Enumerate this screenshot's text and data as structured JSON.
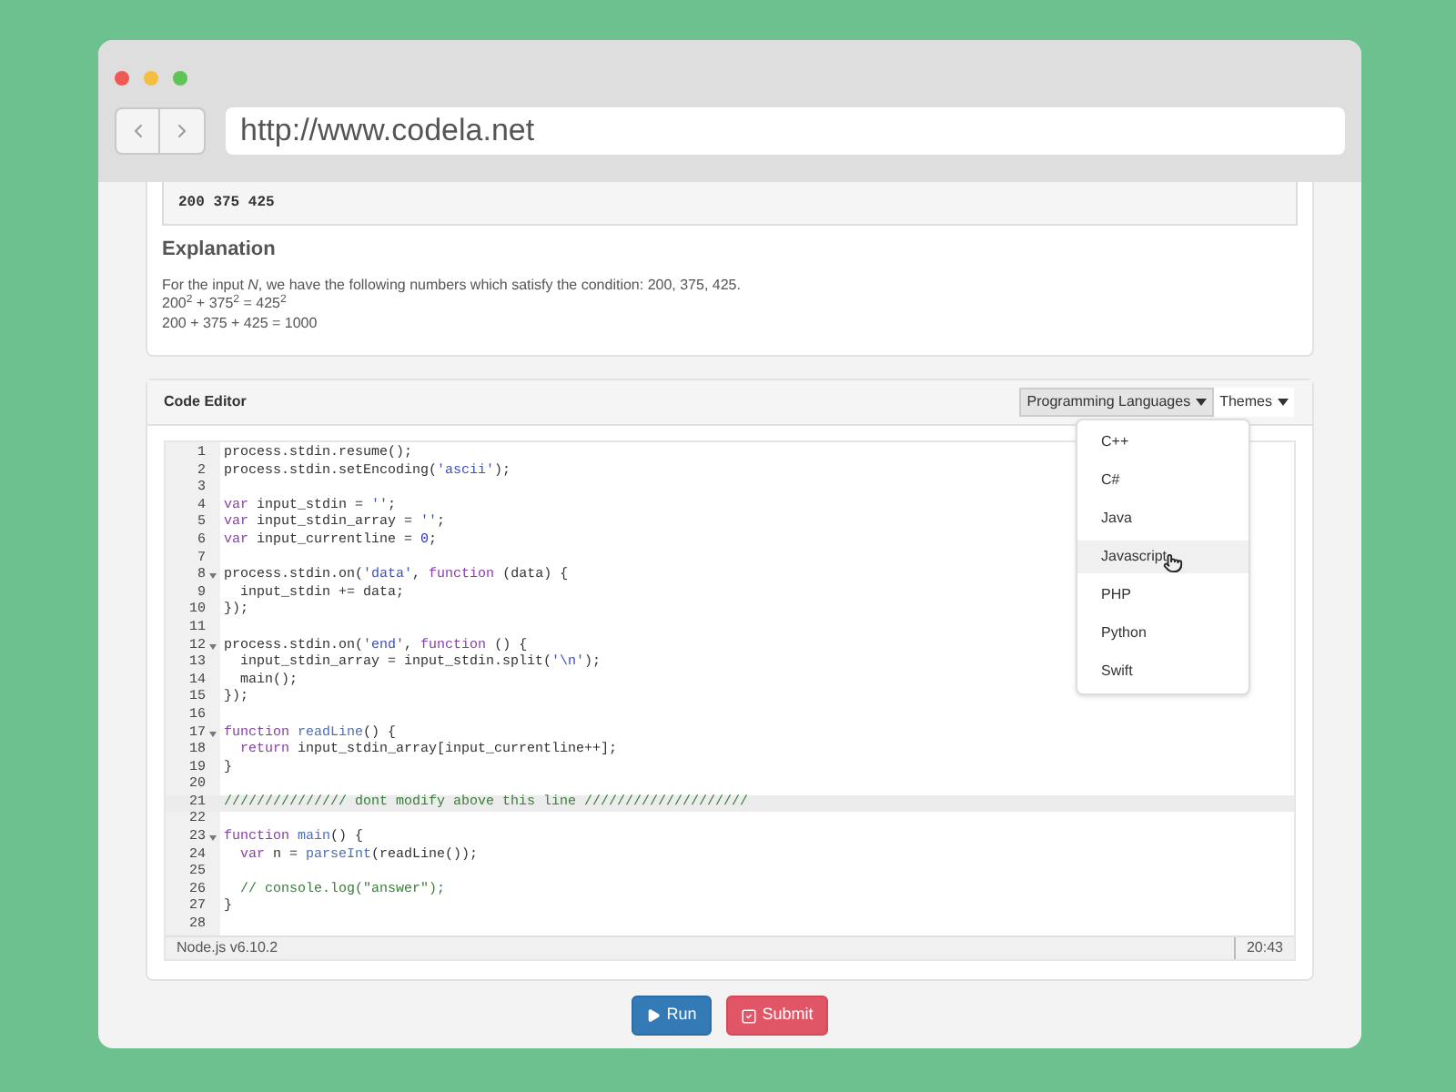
{
  "browser": {
    "url": "http://www.codela.net"
  },
  "sample_output": "200 375 425",
  "explanation": {
    "title": "Explanation",
    "lines": [
      "For the input *N*, we have the following numbers which satisfy the condition: 200, 375, 425.",
      "200$^{2}$ + 375$^{2}$ = 425$^{2}$",
      "200 + 375 + 425 = 1000"
    ]
  },
  "code_editor": {
    "title": "Code Editor",
    "toolbar": [
      {
        "label": "Programming Languages",
        "expanded": true
      },
      {
        "label": "Themes",
        "expanded": false
      }
    ],
    "language_menu": [
      {
        "label": "C++",
        "selected": false
      },
      {
        "label": "C#",
        "selected": false
      },
      {
        "label": "Java",
        "selected": false
      },
      {
        "label": "Javascript",
        "selected": true
      },
      {
        "label": "PHP",
        "selected": false
      },
      {
        "label": "Python",
        "selected": false
      },
      {
        "label": "Swift",
        "selected": false
      }
    ],
    "lines": [
      {
        "number": "1",
        "fold": false,
        "active": false,
        "tokens": [
          {
            "text": "process.stdin.resume();",
            "kind": "plain"
          }
        ]
      },
      {
        "number": "2",
        "fold": false,
        "active": false,
        "tokens": [
          {
            "text": "process.stdin.setEncoding(",
            "kind": "plain"
          },
          {
            "text": "'ascii'",
            "kind": "string"
          },
          {
            "text": ");",
            "kind": "plain"
          }
        ]
      },
      {
        "number": "3",
        "fold": false,
        "active": false
      },
      {
        "number": "4",
        "fold": false,
        "active": false,
        "tokens": [
          {
            "text": "var",
            "kind": "keyword"
          },
          {
            "text": " input_stdin = ",
            "kind": "plain"
          },
          {
            "text": "''",
            "kind": "string"
          },
          {
            "text": ";",
            "kind": "plain"
          }
        ]
      },
      {
        "number": "5",
        "fold": false,
        "active": false,
        "tokens": [
          {
            "text": "var",
            "kind": "keyword"
          },
          {
            "text": " input_stdin_array = ",
            "kind": "plain"
          },
          {
            "text": "''",
            "kind": "string"
          },
          {
            "text": ";",
            "kind": "plain"
          }
        ]
      },
      {
        "number": "6",
        "fold": false,
        "active": false,
        "tokens": [
          {
            "text": "var",
            "kind": "keyword"
          },
          {
            "text": " input_currentline = ",
            "kind": "plain"
          },
          {
            "text": "0",
            "kind": "number"
          },
          {
            "text": ";",
            "kind": "plain"
          }
        ]
      },
      {
        "number": "7",
        "fold": false,
        "active": false
      },
      {
        "number": "8",
        "fold": true,
        "active": false,
        "tokens": [
          {
            "text": "process.stdin.on(",
            "kind": "plain"
          },
          {
            "text": "'data'",
            "kind": "string"
          },
          {
            "text": ", ",
            "kind": "plain"
          },
          {
            "text": "function",
            "kind": "keyword"
          },
          {
            "text": " (data) {",
            "kind": "plain"
          }
        ]
      },
      {
        "number": "9",
        "fold": false,
        "active": false,
        "tokens": [
          {
            "text": "  input_stdin += data;",
            "kind": "plain"
          }
        ]
      },
      {
        "number": "10",
        "fold": false,
        "active": false,
        "tokens": [
          {
            "text": "});",
            "kind": "plain"
          }
        ]
      },
      {
        "number": "11",
        "fold": false,
        "active": false
      },
      {
        "number": "12",
        "fold": true,
        "active": false,
        "tokens": [
          {
            "text": "process.stdin.on(",
            "kind": "plain"
          },
          {
            "text": "'end'",
            "kind": "string"
          },
          {
            "text": ", ",
            "kind": "plain"
          },
          {
            "text": "function",
            "kind": "keyword"
          },
          {
            "text": " () {",
            "kind": "plain"
          }
        ]
      },
      {
        "number": "13",
        "fold": false,
        "active": false,
        "tokens": [
          {
            "text": "  input_stdin_array = input_stdin.split(",
            "kind": "plain"
          },
          {
            "text": "'\\n'",
            "kind": "string"
          },
          {
            "text": ");",
            "kind": "plain"
          }
        ]
      },
      {
        "number": "14",
        "fold": false,
        "active": false,
        "tokens": [
          {
            "text": "  main();",
            "kind": "plain"
          }
        ]
      },
      {
        "number": "15",
        "fold": false,
        "active": false,
        "tokens": [
          {
            "text": "});",
            "kind": "plain"
          }
        ]
      },
      {
        "number": "16",
        "fold": false,
        "active": false
      },
      {
        "number": "17",
        "fold": true,
        "active": false,
        "tokens": [
          {
            "text": "function ",
            "kind": "keyword"
          },
          {
            "text": "readLine",
            "kind": "name"
          },
          {
            "text": "() {",
            "kind": "plain"
          }
        ]
      },
      {
        "number": "18",
        "fold": false,
        "active": false,
        "tokens": [
          {
            "text": "  return",
            "kind": "keyword"
          },
          {
            "text": " input_stdin_array[input_currentline++];",
            "kind": "plain"
          }
        ]
      },
      {
        "number": "19",
        "fold": false,
        "active": false,
        "tokens": [
          {
            "text": "}",
            "kind": "plain"
          }
        ]
      },
      {
        "number": "20",
        "fold": false,
        "active": false
      },
      {
        "number": "21",
        "fold": false,
        "active": true,
        "tokens": [
          {
            "text": "/////////////// dont modify above this line ////////////////////",
            "kind": "comment"
          }
        ]
      },
      {
        "number": "22",
        "fold": false,
        "active": false
      },
      {
        "number": "23",
        "fold": true,
        "active": false,
        "tokens": [
          {
            "text": "function ",
            "kind": "keyword"
          },
          {
            "text": "main",
            "kind": "name"
          },
          {
            "text": "() {",
            "kind": "plain"
          }
        ]
      },
      {
        "number": "24",
        "fold": false,
        "active": false,
        "tokens": [
          {
            "text": "  var",
            "kind": "keyword"
          },
          {
            "text": " n = ",
            "kind": "plain"
          },
          {
            "text": "parseInt",
            "kind": "name"
          },
          {
            "text": "(readLine());",
            "kind": "plain"
          }
        ]
      },
      {
        "number": "25",
        "fold": false,
        "active": false
      },
      {
        "number": "26",
        "fold": false,
        "active": false,
        "tokens": [
          {
            "text": "  // console.log(\"answer\");",
            "kind": "comment"
          }
        ]
      },
      {
        "number": "27",
        "fold": false,
        "active": false,
        "tokens": [
          {
            "text": "}",
            "kind": "plain"
          }
        ]
      },
      {
        "number": "28",
        "fold": false,
        "active": false
      }
    ],
    "status_bar": {
      "runtime": "Node.js v6.10.2",
      "position": "20:43"
    }
  },
  "buttons": [
    {
      "label": "Run",
      "kind": "run"
    },
    {
      "label": "Submit",
      "kind": "submit"
    }
  ]
}
